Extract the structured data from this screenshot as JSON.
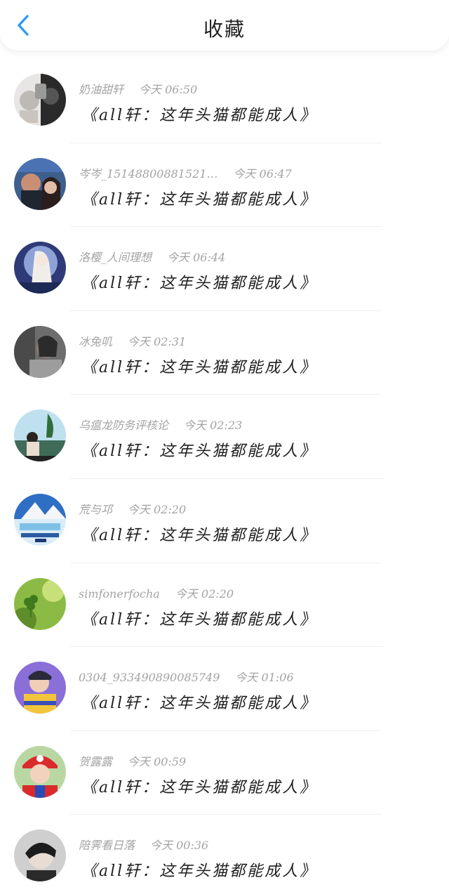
{
  "header": {
    "title": "收藏",
    "back_icon": "chevron-left-icon",
    "accent_color": "#2f9bf0"
  },
  "items": [
    {
      "user": "奶油甜轩",
      "date": "今天",
      "time": "06:50",
      "title": "《all轩：这年头猫都能成人》"
    },
    {
      "user": "岑岑_15148800881521…",
      "date": "今天",
      "time": "06:47",
      "title": "《all轩：这年头猫都能成人》"
    },
    {
      "user": "洛樱_人间理想",
      "date": "今天",
      "time": "06:44",
      "title": "《all轩：这年头猫都能成人》"
    },
    {
      "user": "冰兔叽",
      "date": "今天",
      "time": "02:31",
      "title": "《all轩：这年头猫都能成人》"
    },
    {
      "user": "乌瘟龙防务评核论",
      "date": "今天",
      "time": "02:23",
      "title": "《all轩：这年头猫都能成人》"
    },
    {
      "user": "荒与邛",
      "date": "今天",
      "time": "02:20",
      "title": "《all轩：这年头猫都能成人》"
    },
    {
      "user": "simfonerfocha",
      "date": "今天",
      "time": "02:20",
      "title": "《all轩：这年头猫都能成人》"
    },
    {
      "user": "0304_933490890085749",
      "date": "今天",
      "time": "01:06",
      "title": "《all轩：这年头猫都能成人》"
    },
    {
      "user": "贺露露",
      "date": "今天",
      "time": "00:59",
      "title": "《all轩：这年头猫都能成人》"
    },
    {
      "user": "陪霁看日落",
      "date": "今天",
      "time": "00:36",
      "title": "《all轩：这年头猫都能成人》"
    }
  ]
}
